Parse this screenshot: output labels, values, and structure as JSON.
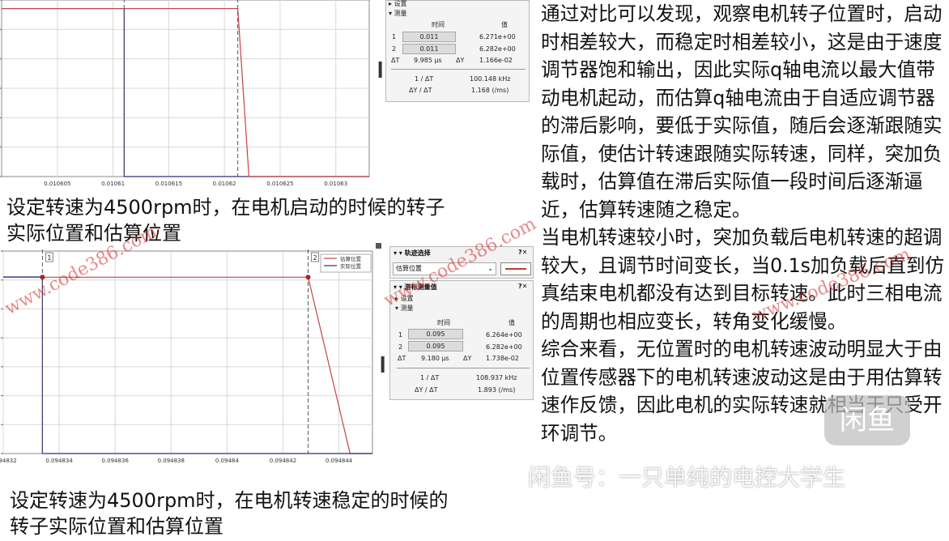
{
  "chart_data": [
    {
      "type": "line",
      "title": "",
      "xlabel": "",
      "ylabel": "",
      "x_ticks": [
        "0.010605",
        "0.01061",
        "0.010615",
        "0.01062",
        "0.010625",
        "0.01063"
      ],
      "x_tick_values": [
        0.010605,
        0.01061,
        0.010615,
        0.01062,
        0.010625,
        0.01063
      ],
      "xlim": [
        0.0106,
        0.010633
      ],
      "grid": true,
      "cursors": [
        {
          "x": 0.011
        },
        {
          "x": 0.011
        }
      ],
      "series": [
        {
          "color": "#2b2b8c",
          "points": [
            [
              0.0106,
              6.28
            ],
            [
              0.010611,
              6.28
            ],
            [
              0.010611,
              0.0
            ],
            [
              0.010633,
              0.0
            ]
          ]
        },
        {
          "color": "#c44444",
          "points": [
            [
              0.0106,
              6.28
            ],
            [
              0.0106212,
              6.28
            ],
            [
              0.0106222,
              0.0
            ],
            [
              0.010633,
              0.0
            ]
          ]
        }
      ],
      "cursor_panel": {
        "sections": [
          "设置",
          "测量"
        ],
        "col_time": "时间",
        "col_value": "值",
        "rows": [
          {
            "id": "1",
            "time": "0.011",
            "value": "6.271e+00"
          },
          {
            "id": "2",
            "time": "0.011",
            "value": "6.282e+00"
          }
        ],
        "delta_t_label": "ΔT",
        "delta_t": "9.985 µs",
        "delta_y_label": "ΔY",
        "delta_y": "1.166e-02",
        "inv_dt_label": "1 / ΔT",
        "inv_dt": "100.148 kHz",
        "slope_label": "ΔY / ΔT",
        "slope": "1.168 (/ms)"
      }
    },
    {
      "type": "line",
      "title": "",
      "xlabel": "",
      "ylabel": "",
      "legend": [
        "估算位置",
        "实际位置"
      ],
      "legend_position": "top-right",
      "x_ticks": [
        "0.094832",
        "0.094834",
        "0.094836",
        "0.094838",
        "0.09484",
        "0.094842",
        "0.094844"
      ],
      "x_tick_values": [
        0.094832,
        0.094834,
        0.094836,
        0.094838,
        0.09484,
        0.094842,
        0.094844
      ],
      "xlim": [
        0.094832,
        0.0948452
      ],
      "grid": true,
      "cursors": [
        {
          "label": "1",
          "x": 0.095
        },
        {
          "label": "2",
          "x": 0.095
        }
      ],
      "series": [
        {
          "name": "估算位置",
          "color": "#c44444",
          "points": [
            [
              0.094832,
              6.27
            ],
            [
              0.0948429,
              6.27
            ],
            [
              0.0948444,
              0.0
            ],
            [
              0.0948452,
              0.0
            ]
          ]
        },
        {
          "name": "实际位置",
          "color": "#2b2b8c",
          "points": [
            [
              0.094832,
              6.28
            ],
            [
              0.0948334,
              6.28
            ],
            [
              0.0948334,
              0.0
            ],
            [
              0.0948452,
              0.0
            ]
          ]
        }
      ],
      "trace_panel": {
        "title": "轨迹选择",
        "selected": "估算位置"
      },
      "cursor_panel": {
        "title": "游标测量值",
        "sections": [
          "设置",
          "测量"
        ],
        "col_time": "时间",
        "col_value": "值",
        "rows": [
          {
            "id": "1",
            "time": "0.095",
            "value": "6.264e+00"
          },
          {
            "id": "2",
            "time": "0.095",
            "value": "6.282e+00"
          }
        ],
        "delta_t_label": "ΔT",
        "delta_t": "9.180 µs",
        "delta_y_label": "ΔY",
        "delta_y": "1.738e-02",
        "inv_dt_label": "1 / ΔT",
        "inv_dt": "108.937 kHz",
        "slope_label": "ΔY / ΔT",
        "slope": "1.893 (/ms)"
      }
    }
  ],
  "captions": {
    "top": [
      "设定转速为4500rpm时，在电机启动的时候的转子",
      "实际位置和估算位置"
    ],
    "bottom": [
      "设定转速为4500rpm时，在电机转速稳定的时候的",
      "转子实际位置和估算位置"
    ]
  },
  "body_paragraphs": [
    "通过对比可以发现，观察电机转子位置时，启动时相差较大，而稳定时相差较小，这是由于速度调节器饱和输出，因此实际q轴电流以最大值带动电机起动，而估算q轴电流由于自适应调节器的滞后影响，要低于实际值，随后会逐渐跟随实际值，使估计转速跟随实际转速，同样，突加负载时，估算值在滞后实际值一段时间后逐渐逼近，估算转速随之稳定。",
    "当电机转速较小时，突加负载后电机转速的超调较大，且调节时间变长，当0.1s加负载后直到仿真结束电机都没有达到目标转速。此时三相电流的周期也相应变长，转角变化缓慢。",
    "综合来看，无位置时的电机转速波动明显大于由位置传感器下的电机转速波动这是由于用估算转速作反馈，因此电机的实际转速就相当于只受开环调节。"
  ],
  "watermarks": [
    "www.code386.com",
    "www.code386.com",
    "www.code386.com"
  ],
  "app_watermark": {
    "logo": "闲鱼",
    "text": "闲鱼号：一只单纯的电控大学生"
  }
}
